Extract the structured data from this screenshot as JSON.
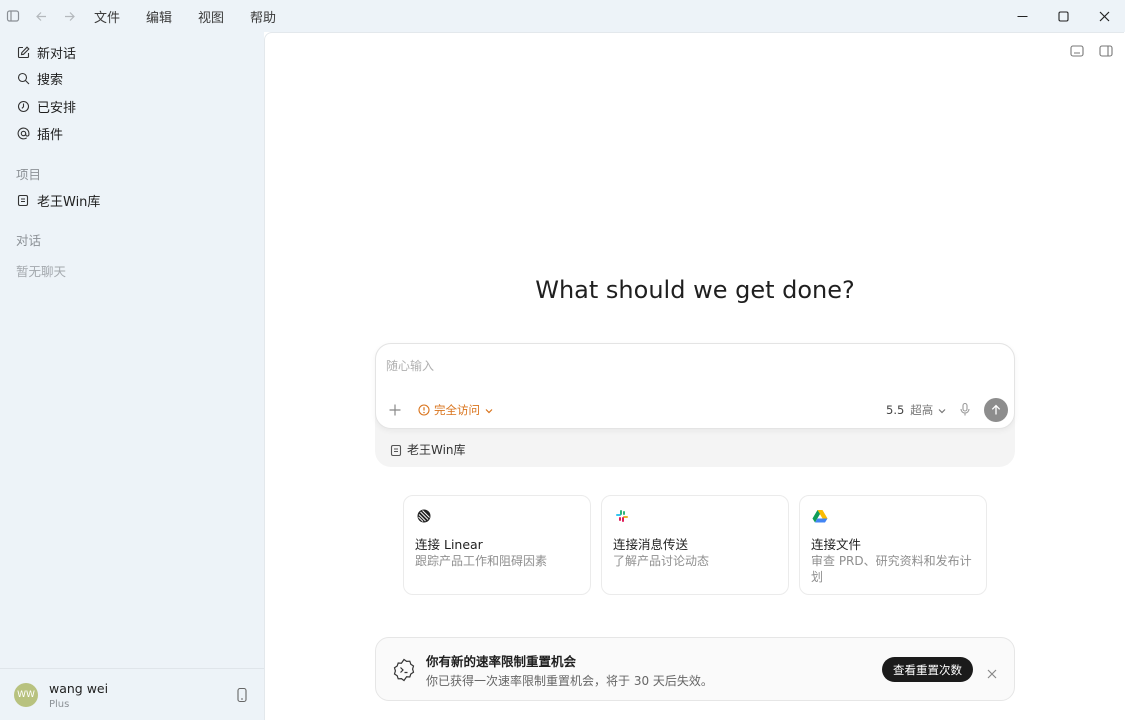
{
  "titlebar": {
    "menu": [
      "文件",
      "编辑",
      "视图",
      "帮助"
    ]
  },
  "sidebar": {
    "nav": [
      {
        "label": "新对话",
        "icon": "compose-icon"
      },
      {
        "label": "搜索",
        "icon": "search-icon"
      },
      {
        "label": "已安排",
        "icon": "clock-icon"
      },
      {
        "label": "插件",
        "icon": "at-icon"
      }
    ],
    "projects_label": "项目",
    "project_item": "老王Win库",
    "chats_label": "对话",
    "no_chats": "暂无聊天",
    "user": {
      "initials": "WW",
      "name": "wang wei",
      "plan": "Plus"
    }
  },
  "main": {
    "headline": "What should we get done?",
    "composer": {
      "placeholder": "随心输入",
      "access_label": "完全访问",
      "model_version": "5.5",
      "model_level": "超高",
      "project_chip": "老王Win库"
    },
    "cards": [
      {
        "title": "连接 Linear",
        "desc": "跟踪产品工作和阻碍因素",
        "icon": "linear-logo-icon"
      },
      {
        "title": "连接消息传送",
        "desc": "了解产品讨论动态",
        "icon": "slack-logo-icon"
      },
      {
        "title": "连接文件",
        "desc": "审查 PRD、研究资料和发布计划",
        "icon": "drive-logo-icon"
      }
    ],
    "banner": {
      "title": "你有新的速率限制重置机会",
      "desc": "你已获得一次速率限制重置机会，将于 30 天后失效。",
      "button": "查看重置次数"
    }
  },
  "colors": {
    "sidebar_bg": "#edf3f8",
    "accent_orange": "#d9731b",
    "send_button": "#8d8d8d",
    "banner_button": "#1b1b1b"
  }
}
